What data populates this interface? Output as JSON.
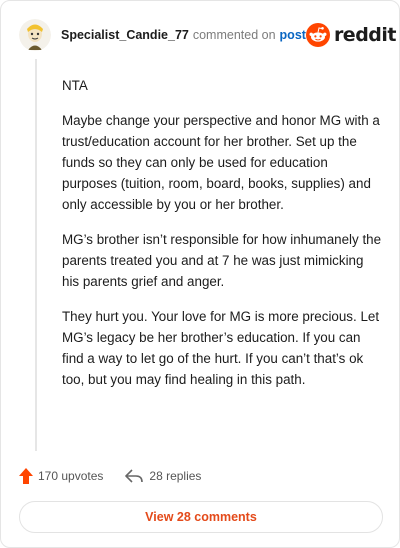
{
  "header": {
    "username": "Specialist_Candie_77",
    "action_text": "commented on",
    "post_link": "post",
    "logo_text": "reddit"
  },
  "comment": {
    "paragraphs": [
      "NTA",
      "Maybe change your perspective and honor MG with a trust/education account for her brother. Set up the funds so they can only be used for education purposes (tuition, room, board, books, supplies) and only accessible by you or her brother.",
      "MG’s brother isn’t responsible for how inhumanely the parents treated you and at 7 he was just mimicking his parents grief and anger.",
      "They hurt you. Your love for MG is more precious. Let MG’s legacy be her brother’s education. If you can find a way to let go of the hurt. If you can’t that’s ok too, but you may find healing in this path."
    ]
  },
  "actions": {
    "upvotes_label": "170 upvotes",
    "replies_label": "28 replies"
  },
  "footer": {
    "view_comments_label": "View 28 comments"
  },
  "colors": {
    "brand": "#ff4500",
    "link": "#0a66c2",
    "button_text": "#e44a1a"
  },
  "icons": [
    "avatar",
    "reddit-snoo-icon",
    "upvote-arrow-icon",
    "reply-icon"
  ]
}
